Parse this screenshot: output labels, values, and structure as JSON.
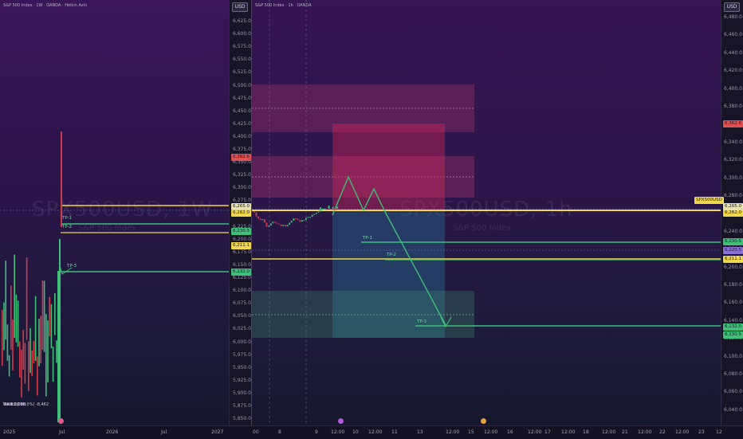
{
  "left_chart": {
    "title": "S&P 500 Index · 1W · OANDA · Heikin Ashi",
    "currency_button": "USD",
    "watermark": "SPX500USD, 1W",
    "watermark_sub": "S&P 500 Index",
    "price_ticks": [
      "6,625.0",
      "6,600.0",
      "6,575.0",
      "6,550.0",
      "6,525.0",
      "6,500.0",
      "6,475.0",
      "6,450.0",
      "6,425.0",
      "6,400.0",
      "6,375.0",
      "6,350.0",
      "6,325.0",
      "6,300.0",
      "6,275.0",
      "6,250.0",
      "6,225.0",
      "6,200.0",
      "6,175.0",
      "6,150.0",
      "6,125.0",
      "6,100.0",
      "6,075.0",
      "6,050.0",
      "6,025.0",
      "6,000.0",
      "5,975.0",
      "5,950.0",
      "5,925.0",
      "5,900.0",
      "5,875.0",
      "5,850.0"
    ],
    "price_labels": [
      {
        "text": "6,362.6",
        "color": "#e05050"
      },
      {
        "text": "6,265.0",
        "color": "#e8e3b0"
      },
      {
        "text": "6,262.0",
        "color": "#f0d84a"
      },
      {
        "text": "6,230.5",
        "color": "#3fbf78"
      },
      {
        "text": "6,211.1",
        "color": "#f0d84a"
      },
      {
        "text": "6,132.0",
        "color": "#3fbf78"
      }
    ],
    "tp_labels": [
      "TP-1",
      "TP-2",
      "TP-3"
    ],
    "info_lines": [
      "-648.2 (-10.0%) -8,462",
      "5 bars, 35d",
      "Vol 3.38 M"
    ],
    "date_labels": [
      "2025",
      "Jul",
      "2026",
      "Jul",
      "2027"
    ]
  },
  "right_chart": {
    "title": "S&P 500 Index · 1h · OANDA",
    "currency_button": "USD",
    "watermark": "SPX500USD, 1h",
    "watermark_sub": "S&P 500 Index",
    "price_ticks": [
      "6,480.0",
      "6,460.0",
      "6,440.0",
      "6,420.0",
      "6,400.0",
      "6,380.0",
      "6,360.0",
      "6,340.0",
      "6,320.0",
      "6,300.0",
      "6,280.0",
      "6,260.0",
      "6,240.0",
      "6,220.0",
      "6,200.0",
      "6,180.0",
      "6,160.0",
      "6,140.0",
      "6,120.0",
      "6,100.0",
      "6,080.0",
      "6,060.0",
      "6,040.0"
    ],
    "price_labels": [
      {
        "text": "6,362.6",
        "color": "#e05050"
      },
      {
        "text": "SPX500USD",
        "color": "#f0d84a"
      },
      {
        "text": "6,262.0",
        "color": "#f0d84a"
      },
      {
        "text": "6,265.0",
        "color": "#e8e3b0"
      },
      {
        "text": "6,230.5",
        "color": "#3fbf78"
      },
      {
        "text": "6,220.5",
        "color": "#8a6fd6"
      },
      {
        "text": "6,211.1",
        "color": "#f0d84a"
      },
      {
        "text": "6,132.0",
        "color": "#3fbf78"
      },
      {
        "text": "6,130.5",
        "color": "#3fbf78"
      }
    ],
    "tp_labels": [
      "TP-1",
      "TP-2",
      "TP-3"
    ],
    "date_labels": [
      "00",
      "8",
      "9",
      "12:00",
      "10",
      "12:00",
      "11",
      "13",
      "12:00",
      "15",
      "12:00",
      "16",
      "12:00",
      "17",
      "12:00",
      "18",
      "12:00",
      "21",
      "12:00",
      "22",
      "12:00",
      "23",
      "12"
    ]
  }
}
